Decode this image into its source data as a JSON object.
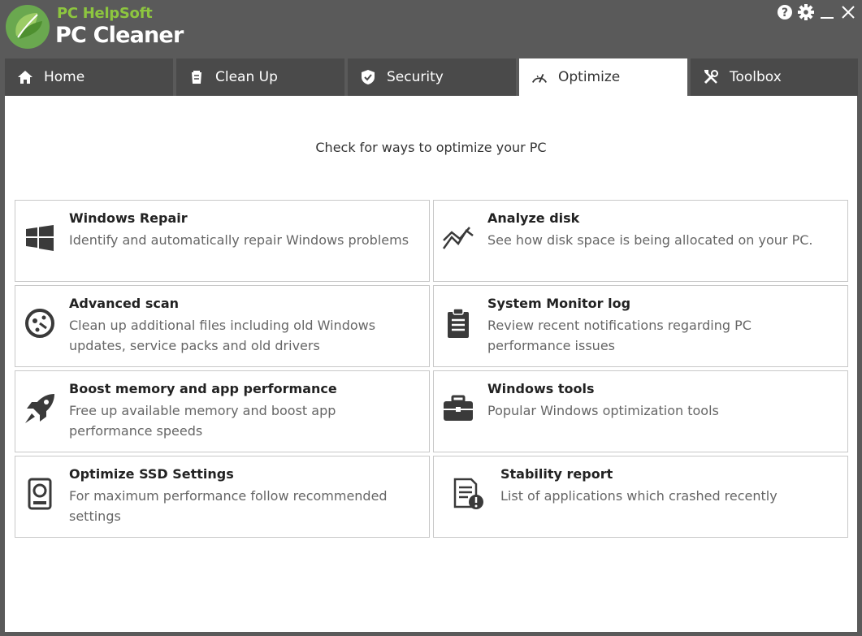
{
  "brand": {
    "company": "PC HelpSoft",
    "product": "PC Cleaner",
    "accent": "#8dc63f"
  },
  "window_controls": {
    "help": "help-icon",
    "settings": "gear-icon",
    "minimize": "minimize-icon",
    "close": "close-icon"
  },
  "tabs": [
    {
      "label": "Home",
      "icon": "home-icon",
      "active": false
    },
    {
      "label": "Clean Up",
      "icon": "broom-icon",
      "active": false
    },
    {
      "label": "Security",
      "icon": "shield-icon",
      "active": false
    },
    {
      "label": "Optimize",
      "icon": "gauge-icon",
      "active": true
    },
    {
      "label": "Toolbox",
      "icon": "tools-icon",
      "active": false
    }
  ],
  "main": {
    "headline": "Check for ways to optimize your PC",
    "cards": [
      {
        "title": "Windows Repair",
        "desc": "Identify and automatically repair Windows problems",
        "icon": "windows-icon"
      },
      {
        "title": "Analyze disk",
        "desc": "See how disk space is being allocated on your PC.",
        "icon": "chart-line-icon"
      },
      {
        "title": "Advanced scan",
        "desc": "Clean up additional files including old Windows updates, service packs and old drivers",
        "icon": "scan-disc-icon"
      },
      {
        "title": "System Monitor log",
        "desc": "Review recent notifications regarding PC performance issues",
        "icon": "clipboard-icon"
      },
      {
        "title": "Boost memory and app performance",
        "desc": "Free up available memory and boost app performance speeds",
        "icon": "rocket-icon"
      },
      {
        "title": "Windows tools",
        "desc": "Popular Windows optimization tools",
        "icon": "toolbox-icon"
      },
      {
        "title": "Optimize SSD Settings",
        "desc": "For maximum performance follow recommended settings",
        "icon": "ssd-icon"
      },
      {
        "title": "Stability report",
        "desc": "List of applications which crashed recently",
        "icon": "report-warning-icon"
      }
    ]
  }
}
